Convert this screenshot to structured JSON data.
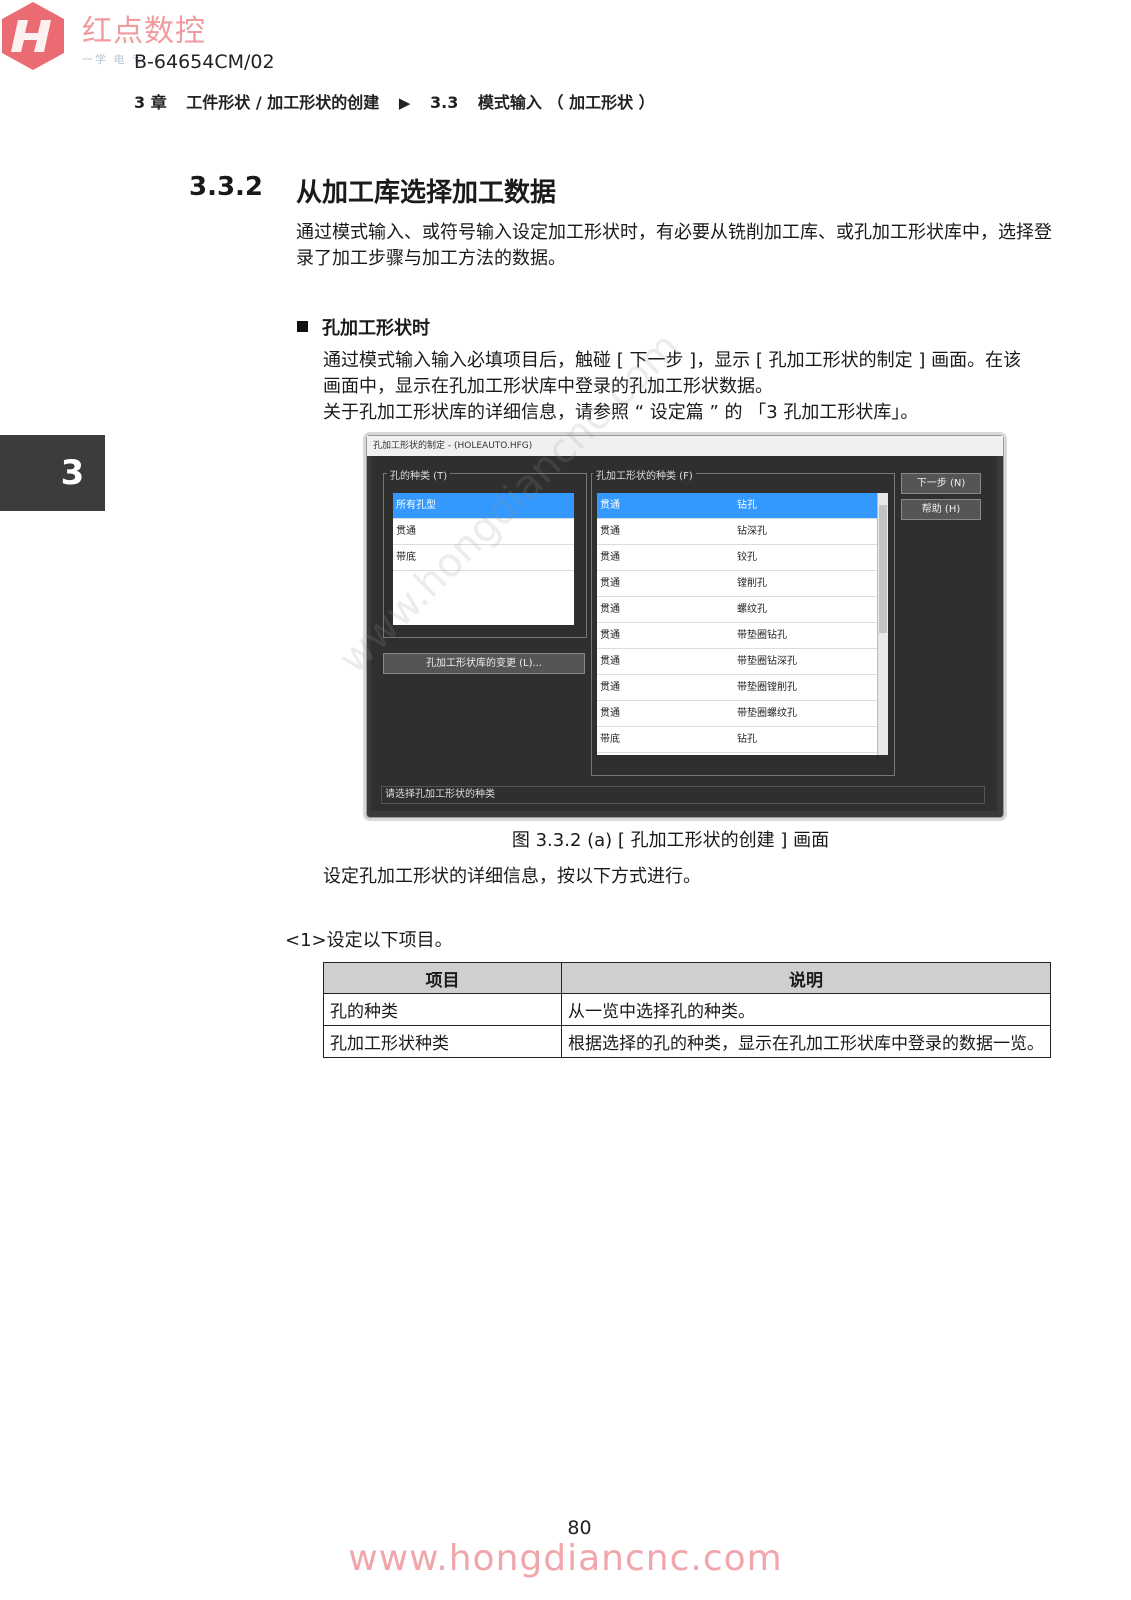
{
  "header": {
    "logo_name": "红点数控",
    "logo_tagline": "一学 电 专 ...",
    "doc_code": "B-64654CM/02",
    "breadcrumb": {
      "chapter": "3 章",
      "chapter_title": "工件形状 / 加工形状的创建",
      "arrow": "▶",
      "section_no": "3.3",
      "section_title": "模式输入 （ 加工形状 ）"
    }
  },
  "side_tab": {
    "number": "3"
  },
  "section": {
    "number": "3.3.2",
    "title": "从加工库选择加工数据",
    "intro": "通过模式输入、或符号输入设定加工形状时，有必要从铣削加工库、或孔加工形状库中，选择登录了加工步骤与加工方法的数据。"
  },
  "subsection": {
    "title": "孔加工形状时",
    "para_line1": "通过模式输入输入必填项目后，触碰 [ 下一步 ]，显示 [ 孔加工形状的制定 ] 画面。在该",
    "para_line2": "画面中，显示在孔加工形状库中登录的孔加工形状数据。",
    "para_line3": "关于孔加工形状库的详细信息，请参照 “ 设定篇 ” 的 「3 孔加工形状库」。"
  },
  "dialog": {
    "title": "孔加工形状的制定 - (HOLEAUTO.HFG)",
    "hole_type_group": "孔的种类 (T)",
    "hole_types": [
      "所有孔型",
      "贯通",
      "带底"
    ],
    "shape_group": "孔加工形状的种类 (F)",
    "shapes": [
      {
        "kind": "贯通",
        "name": "钻孔"
      },
      {
        "kind": "贯通",
        "name": "钻深孔"
      },
      {
        "kind": "贯通",
        "name": "铰孔"
      },
      {
        "kind": "贯通",
        "name": "镗削孔"
      },
      {
        "kind": "贯通",
        "name": "螺纹孔"
      },
      {
        "kind": "贯通",
        "name": "带垫圈钻孔"
      },
      {
        "kind": "贯通",
        "name": "带垫圈钻深孔"
      },
      {
        "kind": "贯通",
        "name": "带垫圈镗削孔"
      },
      {
        "kind": "贯通",
        "name": "带垫圈螺纹孔"
      },
      {
        "kind": "带底",
        "name": "钻孔"
      }
    ],
    "change_library_button": "孔加工形状库的变更 (L)...",
    "next_button": "下一步 (N)",
    "help_button": "帮助 (H)",
    "status": "请选择孔加工形状的种类"
  },
  "figure_caption": "图 3.3.2 (a) [ 孔加工形状的创建 ] 画面",
  "para_after_figure": "设定孔加工形状的详细信息，按以下方式进行。",
  "step1": "<1>设定以下项目。",
  "table": {
    "headers": [
      "项目",
      "说明"
    ],
    "rows": [
      [
        "孔的种类",
        "从一览中选择孔的种类。"
      ],
      [
        "孔加工形状种类",
        "根据选择的孔的种类，显示在孔加工形状库中登录的数据一览。"
      ]
    ]
  },
  "watermark": "www.hongdiancnc.com",
  "page_number": "80",
  "footer_url": "www.hongdiancnc.com",
  "colors": {
    "logo": "#e8515a",
    "selection": "#3399ff",
    "dialog_bg": "#2f2f2f"
  }
}
